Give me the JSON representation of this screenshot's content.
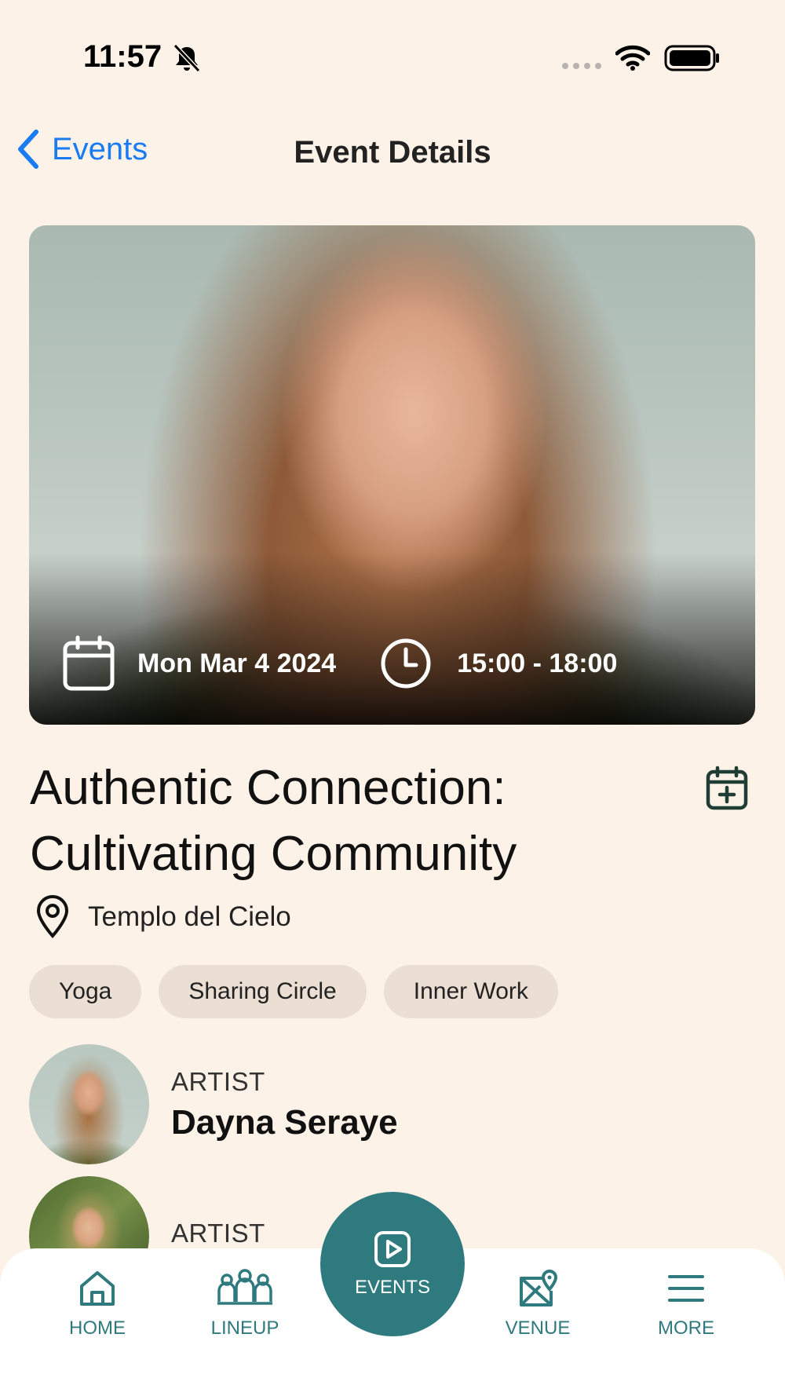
{
  "status_bar": {
    "time": "11:57"
  },
  "nav": {
    "back_label": "Events",
    "title": "Event Details"
  },
  "event": {
    "date": "Mon Mar 4 2024",
    "time_range": "15:00 - 18:00",
    "title_line1": "Authentic Connection:",
    "title_line2": "Cultivating Community",
    "location": "Templo del Cielo",
    "tags": [
      "Yoga",
      "Sharing Circle",
      "Inner Work"
    ]
  },
  "artists": [
    {
      "role": "ARTIST",
      "name": "Dayna Seraye"
    },
    {
      "role": "ARTIST",
      "name": ""
    }
  ],
  "tab_bar": {
    "home": "HOME",
    "lineup": "LINEUP",
    "events": "EVENTS",
    "venue": "VENUE",
    "more": "MORE"
  },
  "colors": {
    "background": "#fdf2e7",
    "accent": "#2f7a7e",
    "link": "#1a7cf2",
    "tag_background": "#eadfd2"
  },
  "icons": {
    "status": [
      "bell-slash-icon",
      "signal-icon",
      "wifi-icon",
      "battery-icon"
    ],
    "hero": [
      "calendar-icon",
      "clock-icon"
    ],
    "actions": [
      "calendar-plus-icon",
      "location-pin-icon"
    ],
    "tabs": [
      "home-icon",
      "lineup-icon",
      "play-icon",
      "map-pin-icon",
      "menu-icon"
    ]
  }
}
